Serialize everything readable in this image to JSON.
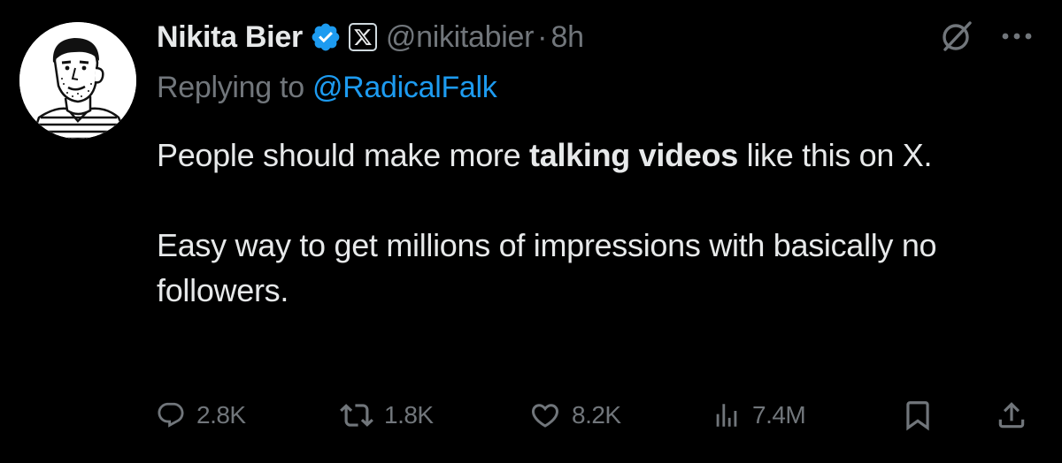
{
  "tweet": {
    "display_name": "Nikita Bier",
    "affiliate_label": "X",
    "handle": "@nikitabier",
    "separator": "·",
    "time": "8h",
    "replying_to_prefix": "Replying to ",
    "replying_to_handle": "@RadicalFalk",
    "body": {
      "line1_pre": "People should make more ",
      "line1_bold": "talking videos",
      "line1_post": " like this on X.",
      "line2": "Easy way to get millions of impressions with basically no followers."
    }
  },
  "actions": {
    "replies": "2.8K",
    "reposts": "1.8K",
    "likes": "8.2K",
    "views": "7.4M"
  },
  "colors": {
    "background": "#000000",
    "text": "#e7e9ea",
    "secondary": "#71767b",
    "link": "#1d9bf0",
    "verified": "#1d9bf0"
  },
  "icons": {
    "verified": "verified-badge-icon",
    "affiliate": "x-logo-icon",
    "grok": "grok-icon",
    "more": "more-icon",
    "reply": "reply-icon",
    "repost": "repost-icon",
    "like": "heart-icon",
    "views": "analytics-icon",
    "bookmark": "bookmark-icon",
    "share": "share-icon"
  }
}
